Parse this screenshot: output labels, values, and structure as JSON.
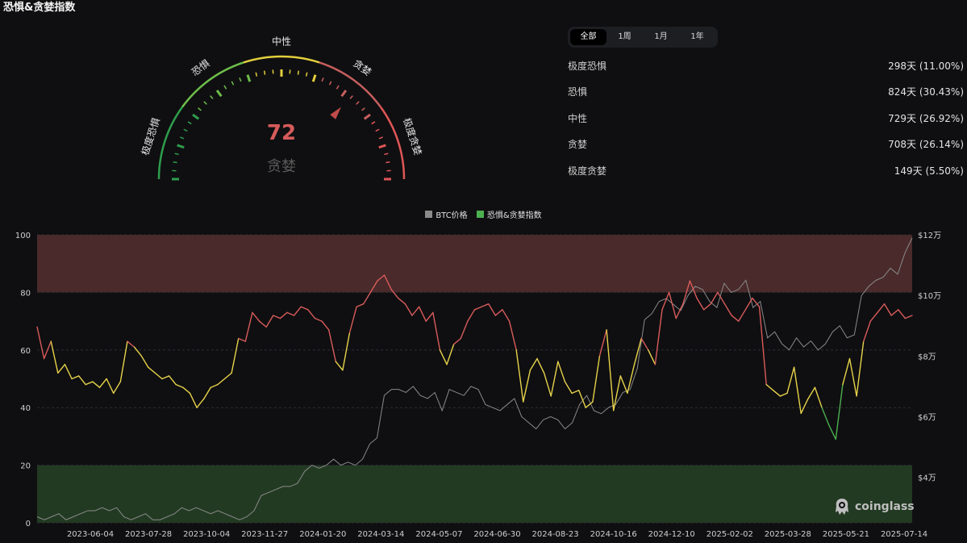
{
  "page": {
    "title": "恐惧&贪婪指数"
  },
  "gauge": {
    "value": 72,
    "label": "贪婪",
    "max": 100,
    "zone_labels": [
      "极度恐惧",
      "恐惧",
      "中性",
      "贪婪",
      "极度贪婪"
    ],
    "colors": {
      "extreme_fear": "#2e9d4d",
      "fear": "#6fbf4a",
      "neutral": "#e3cf3d",
      "greed": "#c75e5e",
      "extreme_greed": "#e05656",
      "needle": "#c24b4b"
    }
  },
  "tabs": {
    "items": [
      "全部",
      "1周",
      "1月",
      "1年"
    ],
    "active": 0
  },
  "stats": [
    {
      "label": "极度恐惧",
      "value": "298天 (11.00%)"
    },
    {
      "label": "恐惧",
      "value": "824天 (30.43%)"
    },
    {
      "label": "中性",
      "value": "729天 (26.92%)"
    },
    {
      "label": "贪婪",
      "value": "708天 (26.14%)"
    },
    {
      "label": "极度贪婪",
      "value": "149天 (5.50%)"
    }
  ],
  "legend": {
    "btc": "BTC价格",
    "fgi": "恐惧&贪婪指数"
  },
  "brand": "coinglass",
  "chart_data": {
    "type": "line",
    "x_ticks": [
      "2023-06-04",
      "2023-07-28",
      "2023-10-04",
      "2023-11-27",
      "2024-01-20",
      "2024-03-14",
      "2024-05-07",
      "2024-06-30",
      "2024-08-23",
      "2024-10-16",
      "2024-12-10",
      "2025-02-02",
      "2025-03-28",
      "2025-05-21",
      "2025-07-14"
    ],
    "y_left": {
      "ticks": [
        "0",
        "20",
        "40",
        "60",
        "80",
        "100"
      ],
      "range": [
        0,
        100
      ]
    },
    "y_right": {
      "ticks": [
        "$4万",
        "$6万",
        "$8万",
        "$10万",
        "$12万"
      ],
      "range": [
        2.5,
        12
      ]
    },
    "bands": {
      "extreme_greed": [
        80,
        100
      ],
      "extreme_fear": [
        0,
        20
      ]
    },
    "colors": {
      "btc": "#8a8a8a",
      "greed": "#d95b5b",
      "neutral": "#e7d34a",
      "fear": "#4caf50",
      "greed_band": "#4a2a2a",
      "fear_band": "#223a22"
    },
    "series": [
      {
        "name": "恐惧&贪婪指数",
        "values": [
          68,
          57,
          63,
          52,
          55,
          50,
          51,
          48,
          49,
          47,
          50,
          45,
          49,
          63,
          61,
          58,
          54,
          52,
          50,
          51,
          48,
          47,
          45,
          40,
          43,
          47,
          48,
          50,
          52,
          64,
          63,
          73,
          70,
          68,
          72,
          71,
          73,
          72,
          75,
          74,
          71,
          70,
          67,
          56,
          53,
          66,
          75,
          76,
          80,
          84,
          86,
          81,
          78,
          76,
          72,
          75,
          70,
          73,
          60,
          55,
          62,
          64,
          70,
          74,
          75,
          76,
          72,
          74,
          70,
          60,
          42,
          53,
          57,
          52,
          44,
          56,
          49,
          45,
          46,
          40,
          42,
          58,
          67,
          39,
          51,
          45,
          55,
          64,
          60,
          55,
          74,
          80,
          71,
          76,
          84,
          78,
          74,
          76,
          80,
          76,
          72,
          70,
          74,
          78,
          75,
          48,
          46,
          44,
          45,
          54,
          38,
          43,
          47,
          40,
          34,
          29,
          48,
          57,
          44,
          63,
          70,
          73,
          76,
          72,
          74,
          71,
          72
        ]
      },
      {
        "name": "BTC价格",
        "values": [
          2.7,
          2.6,
          2.7,
          2.8,
          2.6,
          2.7,
          2.8,
          2.9,
          2.9,
          3.0,
          2.9,
          3.0,
          2.7,
          2.6,
          2.7,
          2.8,
          2.6,
          2.6,
          2.7,
          2.8,
          3.0,
          2.9,
          3.0,
          2.9,
          2.8,
          2.9,
          2.8,
          2.7,
          2.6,
          2.7,
          2.9,
          3.4,
          3.5,
          3.6,
          3.7,
          3.7,
          3.8,
          4.2,
          4.4,
          4.3,
          4.4,
          4.6,
          4.4,
          4.5,
          4.4,
          4.6,
          5.1,
          5.3,
          6.7,
          6.9,
          6.9,
          6.8,
          7.0,
          6.7,
          6.6,
          6.8,
          6.2,
          6.9,
          6.8,
          6.7,
          7.0,
          6.9,
          6.4,
          6.3,
          6.2,
          6.4,
          6.6,
          6.0,
          5.8,
          5.6,
          5.9,
          6.0,
          5.9,
          5.6,
          5.8,
          6.4,
          6.7,
          6.2,
          6.1,
          6.3,
          6.4,
          6.8,
          6.9,
          7.6,
          9.2,
          9.4,
          9.8,
          9.9,
          9.7,
          9.5,
          10.0,
          10.3,
          10.2,
          9.8,
          9.6,
          10.4,
          10.1,
          10.2,
          10.5,
          9.6,
          9.8,
          8.6,
          8.8,
          8.4,
          8.2,
          8.6,
          8.3,
          8.5,
          8.2,
          8.4,
          8.8,
          9.0,
          8.6,
          8.7,
          10.0,
          10.3,
          10.5,
          10.6,
          10.9,
          10.7,
          11.4,
          11.9
        ]
      }
    ]
  }
}
